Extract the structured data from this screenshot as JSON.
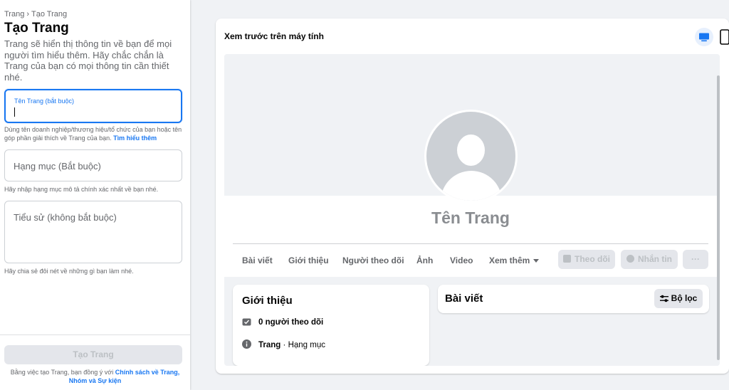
{
  "breadcrumb": {
    "parent": "Trang",
    "separator": "›",
    "current": "Tạo Trang"
  },
  "page_title": "Tạo Trang",
  "description": "Trang sẽ hiển thị thông tin về bạn để mọi người tìm hiểu thêm. Hãy chắc chắn là Trang của bạn có mọi thông tin cần thiết nhé.",
  "form": {
    "name_field": {
      "label": "Tên Trang (bắt buộc)",
      "value": ""
    },
    "name_hint": "Dùng tên doanh nghiệp/thương hiệu/tổ chức của bạn hoặc tên góp phần giải thích về Trang của bạn.",
    "name_hint_link": "Tìm hiểu thêm",
    "category_field": {
      "placeholder": "Hạng mục (Bắt buộc)"
    },
    "category_hint": "Hãy nhập hạng mục mô tả chính xác nhất về bạn nhé.",
    "bio_field": {
      "placeholder": "Tiểu sử (không bắt buộc)"
    },
    "bio_hint": "Hãy chia sẻ đôi nét về những gì bạn làm nhé."
  },
  "footer": {
    "create_button": "Tạo Trang",
    "terms_prefix": "Bằng việc tạo Trang, bạn đồng ý với",
    "terms_link": "Chính sách về Trang, Nhóm và Sự kiện"
  },
  "preview": {
    "title": "Xem trước trên máy tính",
    "devices": [
      "desktop-icon",
      "mobile-icon"
    ],
    "page_name": "Tên Trang",
    "tabs": [
      "Bài viết",
      "Giới thiệu",
      "Người theo dõi",
      "Ảnh",
      "Video",
      "Xem thêm"
    ],
    "follow_button": "Theo dõi",
    "message_button": "Nhắn tin",
    "more_button": "···",
    "intro": {
      "title": "Giới thiệu",
      "followers": "0 người theo dõi",
      "page_label": "Trang",
      "separator": "·",
      "category": "Hạng mục"
    },
    "posts": {
      "title": "Bài viết",
      "filter_button": "Bộ lọc"
    }
  },
  "colors": {
    "accent": "#1877f2",
    "muted": "#65676b",
    "disabled": "#bcc0c4",
    "background": "#f0f2f5"
  }
}
